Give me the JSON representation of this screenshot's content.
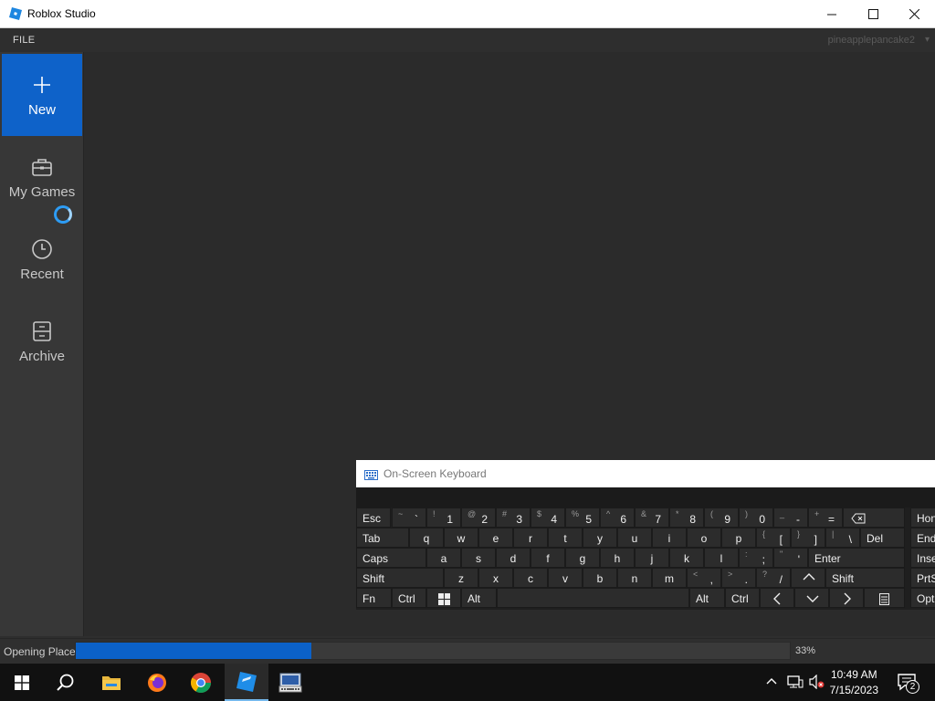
{
  "window": {
    "title": "Roblox Studio"
  },
  "menu": {
    "file": "FILE",
    "username": "pineapplepancake2"
  },
  "sidebar": {
    "items": [
      {
        "label": "New",
        "icon": "plus-icon",
        "active": true
      },
      {
        "label": "My Games",
        "icon": "briefcase-icon"
      },
      {
        "label": "Recent",
        "icon": "clock-icon"
      },
      {
        "label": "Archive",
        "icon": "archive-box-icon"
      }
    ]
  },
  "status": {
    "label": "Opening Place",
    "progress": 33,
    "progress_text": "33%"
  },
  "osk": {
    "title": "On-Screen Keyboard",
    "row1": [
      {
        "m": "Esc"
      },
      {
        "s": "~",
        "m": "`"
      },
      {
        "s": "!",
        "m": "1"
      },
      {
        "s": "@",
        "m": "2"
      },
      {
        "s": "#",
        "m": "3"
      },
      {
        "s": "$",
        "m": "4"
      },
      {
        "s": "%",
        "m": "5"
      },
      {
        "s": "^",
        "m": "6"
      },
      {
        "s": "&",
        "m": "7"
      },
      {
        "s": "*",
        "m": "8"
      },
      {
        "s": "(",
        "m": "9"
      },
      {
        "s": ")",
        "m": "0"
      },
      {
        "s": "_",
        "m": "-"
      },
      {
        "s": "+",
        "m": "="
      },
      {
        "m": "⌫"
      }
    ],
    "row2": [
      "Tab",
      "q",
      "w",
      "e",
      "r",
      "t",
      "y",
      "u",
      "i",
      "o",
      "p"
    ],
    "row2_sym": [
      {
        "s": "{",
        "m": "["
      },
      {
        "s": "}",
        "m": "]"
      },
      {
        "s": "|",
        "m": "\\"
      }
    ],
    "row2_end": "Del",
    "row3": [
      "Caps",
      "a",
      "s",
      "d",
      "f",
      "g",
      "h",
      "j",
      "k",
      "l"
    ],
    "row3_sym": [
      {
        "s": ":",
        "m": ";"
      },
      {
        "s": "\"",
        "m": "'"
      }
    ],
    "row3_end": "Enter",
    "row4": [
      "Shift",
      "z",
      "x",
      "c",
      "v",
      "b",
      "n",
      "m"
    ],
    "row4_sym": [
      {
        "s": "<",
        "m": ","
      },
      {
        "s": ">",
        "m": "."
      },
      {
        "s": "?",
        "m": "/"
      }
    ],
    "row4_end": "Shift",
    "row5": {
      "fn": "Fn",
      "ctrl": "Ctrl",
      "alt": "Alt",
      "alt2": "Alt",
      "ctrl2": "Ctrl"
    },
    "side": [
      "Hon",
      "End",
      "Inse",
      "PrtS",
      "Opt"
    ]
  },
  "taskbar": {
    "time": "10:49 AM",
    "date": "7/15/2023",
    "notifications": "2"
  }
}
